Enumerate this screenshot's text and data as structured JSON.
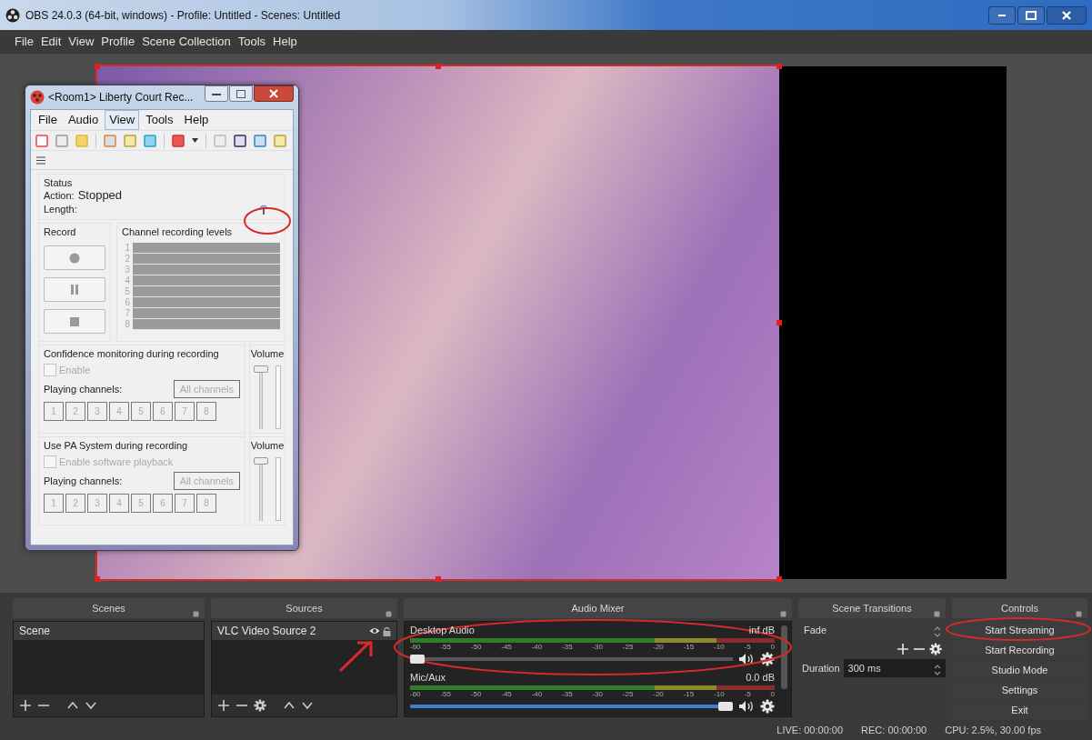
{
  "window": {
    "title": "OBS 24.0.3 (64-bit, windows) - Profile: Untitled - Scenes: Untitled"
  },
  "menu": [
    "File",
    "Edit",
    "View",
    "Profile",
    "Scene Collection",
    "Tools",
    "Help"
  ],
  "recorder": {
    "title": "<Room1> Liberty Court Rec...",
    "menu": [
      {
        "label": "File",
        "selected": false
      },
      {
        "label": "Audio",
        "selected": false
      },
      {
        "label": "View",
        "selected": true
      },
      {
        "label": "Tools",
        "selected": false
      },
      {
        "label": "Help",
        "selected": false
      }
    ],
    "status": {
      "heading": "Status",
      "action_label": "Action:",
      "action_value": "Stopped",
      "length_label": "Length:"
    },
    "record_heading": "Record",
    "levels": {
      "heading": "Channel recording levels",
      "channels": [
        "1",
        "2",
        "3",
        "4",
        "5",
        "6",
        "7",
        "8"
      ]
    },
    "monitoring": [
      {
        "heading": "Confidence monitoring during recording",
        "checkbox": {
          "label": "Enable",
          "checked": false,
          "disabled": true
        },
        "playing_label": "Playing channels:",
        "all_channels": "All channels",
        "channels": [
          "1",
          "2",
          "3",
          "4",
          "5",
          "6",
          "7",
          "8"
        ],
        "volume_label": "Volume",
        "volume": {
          "level": 1
        }
      },
      {
        "heading": "Use PA System during recording",
        "checkbox": {
          "label": "Enable software playback",
          "checked": false,
          "disabled": true
        },
        "playing_label": "Playing channels:",
        "all_channels": "All channels",
        "channels": [
          "1",
          "2",
          "3",
          "4",
          "5",
          "6",
          "7",
          "8"
        ],
        "volume_label": "Volume",
        "volume": {
          "level": 1
        }
      }
    ]
  },
  "docks": {
    "scenes": {
      "title": "Scenes",
      "items": [
        {
          "label": "Scene",
          "selected": true
        }
      ]
    },
    "sources": {
      "title": "Sources",
      "items": [
        {
          "label": "VLC Video Source 2",
          "selected": true,
          "visible": true,
          "locked": false
        }
      ]
    },
    "mixer": {
      "title": "Audio Mixer",
      "channels": [
        {
          "name": "Desktop Audio",
          "reading": "inf dB",
          "scale": [
            "-60",
            "-55",
            "-50",
            "-45",
            "-40",
            "-35",
            "-30",
            "-25",
            "-20",
            "-15",
            "-10",
            "-5",
            "0"
          ],
          "level": 0
        },
        {
          "name": "Mic/Aux",
          "reading": "0.0 dB",
          "scale": [
            "-60",
            "-55",
            "-50",
            "-45",
            "-40",
            "-35",
            "-30",
            "-25",
            "-20",
            "-15",
            "-10",
            "-5",
            "0"
          ],
          "level": 1
        }
      ]
    },
    "transitions": {
      "title": "Scene Transitions",
      "transition": "Fade",
      "duration_label": "Duration",
      "duration": "300 ms"
    },
    "controls": {
      "title": "Controls",
      "buttons": [
        "Start Streaming",
        "Start Recording",
        "Studio Mode",
        "Settings",
        "Exit"
      ]
    }
  },
  "status_bar": {
    "live": "LIVE: 00:00:00",
    "rec": "REC: 00:00:00",
    "cpu": "CPU: 2.5%, 30.00 fps"
  }
}
